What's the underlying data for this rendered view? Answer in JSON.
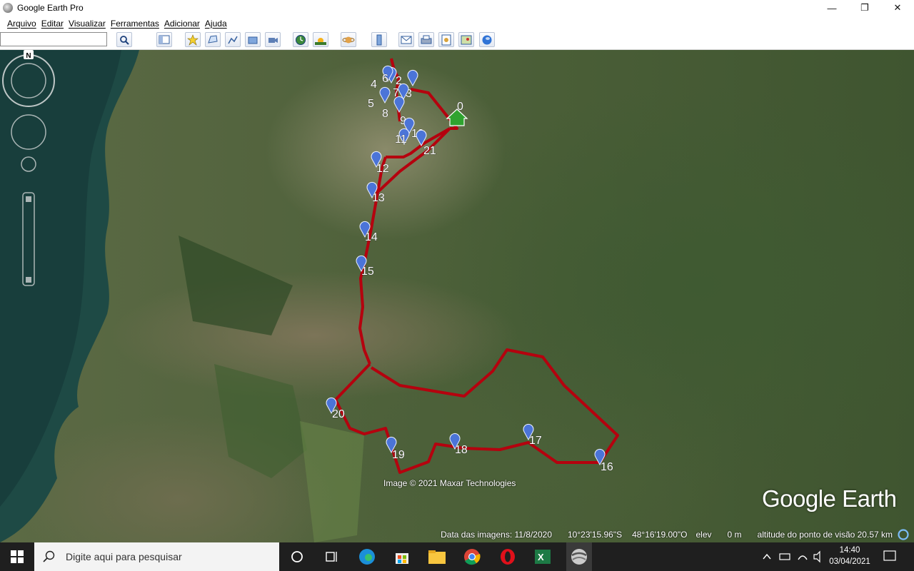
{
  "window": {
    "title": "Google Earth Pro",
    "controls": [
      "—",
      "❐",
      "✕"
    ]
  },
  "menu": [
    "Arquivo",
    "Editar",
    "Visualizar",
    "Ferramentas",
    "Adicionar",
    "Ajuda"
  ],
  "search": {
    "value": "",
    "placeholder": ""
  },
  "toolbar_icons": [
    "search-icon",
    "sidebar-icon",
    "placemark-icon",
    "polygon-icon",
    "path-icon",
    "overlay-icon",
    "record-tour-icon",
    "historical-imagery-icon",
    "sunlight-icon",
    "planets-icon",
    "ruler-icon",
    "email-icon",
    "print-icon",
    "save-image-icon",
    "map-view-icon",
    "google-maps-icon"
  ],
  "map": {
    "home_label": "0",
    "placemarks": [
      "2",
      "3",
      "4",
      "5",
      "6",
      "7",
      "8",
      "9",
      "10",
      "11",
      "12",
      "13",
      "14",
      "15",
      "16",
      "17",
      "18",
      "19",
      "20",
      "21"
    ],
    "route_color": "#b5000e",
    "pin_color": "#4b74d8",
    "home_color": "#2fa32f",
    "compass_north": "N",
    "attribution": "Image © 2021 Maxar Technologies",
    "logo": "Google Earth"
  },
  "status": {
    "image_date": "Data das imagens: 11/8/2020",
    "latitude": "10°23'15.96\"S",
    "longitude": "48°16'19.00\"O",
    "elev_label": "elev",
    "elev_value": "0 m",
    "eye_alt": "altitude do ponto de visão  20.57 km"
  },
  "taskbar": {
    "search_placeholder": "Digite aqui para pesquisar",
    "time": "14:40",
    "date": "03/04/2021"
  }
}
